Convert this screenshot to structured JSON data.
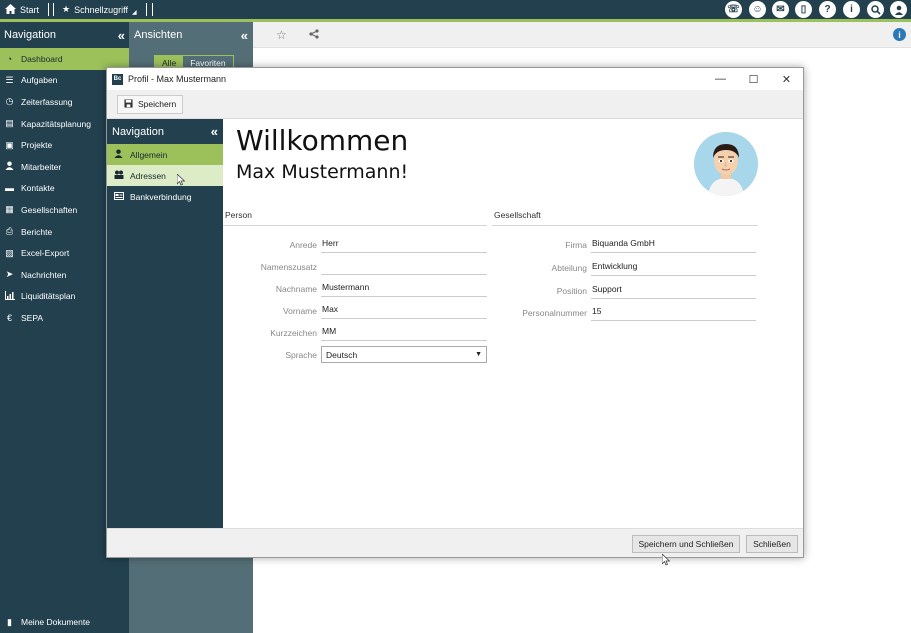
{
  "topbar": {
    "start_label": "Start",
    "quick_label": "Schnellzugriff"
  },
  "leftnav": {
    "title": "Navigation",
    "collapse_icon": "«",
    "items": [
      {
        "label": "Dashboard",
        "icon": "dashboard-icon"
      },
      {
        "label": "Aufgaben",
        "icon": "tasks-icon"
      },
      {
        "label": "Zeiterfassung",
        "icon": "clock-icon"
      },
      {
        "label": "Kapazitätsplanung",
        "icon": "capacity-icon"
      },
      {
        "label": "Projekte",
        "icon": "projects-icon"
      },
      {
        "label": "Mitarbeiter",
        "icon": "employee-icon"
      },
      {
        "label": "Kontakte",
        "icon": "contacts-icon"
      },
      {
        "label": "Gesellschaften",
        "icon": "company-icon"
      },
      {
        "label": "Berichte",
        "icon": "print-icon"
      },
      {
        "label": "Excel-Export",
        "icon": "excel-icon"
      },
      {
        "label": "Nachrichten",
        "icon": "send-icon"
      },
      {
        "label": "Liquiditätsplan",
        "icon": "chart-icon"
      },
      {
        "label": "SEPA",
        "icon": "euro-icon"
      }
    ],
    "bottom_label": "Meine Dokumente"
  },
  "views": {
    "title": "Ansichten",
    "collapse_icon": "«",
    "tab_all": "Alle",
    "tab_favorites": "Favoriten"
  },
  "dialog": {
    "title": "Profil - Max Mustermann",
    "logo": "Bc",
    "save_label": "Speichern",
    "nav_title": "Navigation",
    "nav_collapse": "«",
    "nav_items": [
      {
        "label": "Allgemein"
      },
      {
        "label": "Adressen"
      },
      {
        "label": "Bankverbindung"
      }
    ],
    "welcome_line1": "Willkommen",
    "welcome_line2": "Max Mustermann!",
    "person_header": "Person",
    "company_header": "Gesellschaft",
    "person_fields": [
      {
        "label": "Anrede",
        "value": "Herr"
      },
      {
        "label": "Namenszusatz",
        "value": ""
      },
      {
        "label": "Nachname",
        "value": "Mustermann"
      },
      {
        "label": "Vorname",
        "value": "Max"
      },
      {
        "label": "Kurzzeichen",
        "value": "MM"
      }
    ],
    "language_label": "Sprache",
    "language_value": "Deutsch",
    "company_fields": [
      {
        "label": "Firma",
        "value": "Biquanda GmbH"
      },
      {
        "label": "Abteilung",
        "value": "Entwicklung"
      },
      {
        "label": "Position",
        "value": "Support"
      },
      {
        "label": "Personalnummer",
        "value": "15"
      }
    ],
    "save_close_label": "Speichern und Schließen",
    "close_label": "Schließen"
  },
  "colors": {
    "nav_bg": "#22404e",
    "accent": "#9cc15a",
    "views_bg": "#546e77"
  }
}
